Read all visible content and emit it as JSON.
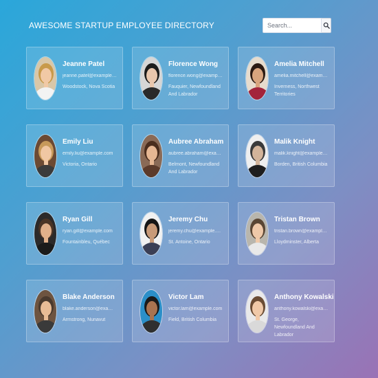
{
  "header": {
    "title": "AWESOME STARTUP EMPLOYEE DIRECTORY",
    "search_placeholder": "Search..."
  },
  "employees": [
    {
      "name": "Jeanne Patel",
      "email": "jeanne.patel@example.com",
      "location": "Woodstock, Nova Scotia",
      "avatar_colors": {
        "bg": "#d9c7a8",
        "hair": "#c89a4a",
        "skin": "#f1c9a5",
        "shirt": "#f3f3f3"
      }
    },
    {
      "name": "Florence Wong",
      "email": "florence.wong@example.com",
      "location": "Fauquier, Newfoundland And Labrador",
      "avatar_colors": {
        "bg": "#d6d6d6",
        "hair": "#1c1c1c",
        "skin": "#e9c7ad",
        "shirt": "#2a2a2a"
      }
    },
    {
      "name": "Amelia Mitchell",
      "email": "amelia.mitchell@example.com",
      "location": "Inverness, Northwest Territories",
      "avatar_colors": {
        "bg": "#e7dccd",
        "hair": "#2b1a12",
        "skin": "#d9a57e",
        "shirt": "#a3243b"
      }
    },
    {
      "name": "Emily Liu",
      "email": "emily.liu@example.com",
      "location": "Victoria, Ontario",
      "avatar_colors": {
        "bg": "#6c4a33",
        "hair": "#c79a5b",
        "skin": "#f0c7a3",
        "shirt": "#3b3b3b"
      }
    },
    {
      "name": "Aubree Abraham",
      "email": "aubree.abraham@example.com",
      "location": "Belmont, Newfoundland And Labrador",
      "avatar_colors": {
        "bg": "#8a6a56",
        "hair": "#4a2d1d",
        "skin": "#e6b793",
        "shirt": "#5c3b2b"
      }
    },
    {
      "name": "Malik Knight",
      "email": "malik.knight@example.com",
      "location": "Borden, British Columbia",
      "avatar_colors": {
        "bg": "#efefef",
        "hair": "#3a3a3a",
        "skin": "#d3b49a",
        "shirt": "#1e1e1e"
      }
    },
    {
      "name": "Ryan Gill",
      "email": "ryan.gill@example.com",
      "location": "Fountainbleu, Québec",
      "avatar_colors": {
        "bg": "#2c2a2a",
        "hair": "#4b3526",
        "skin": "#e1b08a",
        "shirt": "#1b1b1b"
      }
    },
    {
      "name": "Jeremy Chu",
      "email": "jeremy.chu@example.com",
      "location": "St. Antoine, Ontario",
      "avatar_colors": {
        "bg": "#f1f1f1",
        "hair": "#161616",
        "skin": "#c89a78",
        "shirt": "#3b3f55"
      }
    },
    {
      "name": "Tristan Brown",
      "email": "tristan.brown@example.com",
      "location": "Lloydminster, Alberta",
      "avatar_colors": {
        "bg": "#b9b6ad",
        "hair": "#5a4634",
        "skin": "#efc9a9",
        "shirt": "#e9e9e9"
      }
    },
    {
      "name": "Blake Anderson",
      "email": "blake.anderson@example.com",
      "location": "Armstrong, Nunavut",
      "avatar_colors": {
        "bg": "#6e5440",
        "hair": "#4a3a2e",
        "skin": "#e8bc96",
        "shirt": "#3a3a3a"
      }
    },
    {
      "name": "Victor Lam",
      "email": "victor.lam@example.com",
      "location": "Field, British Columbia",
      "avatar_colors": {
        "bg": "#2b8fc8",
        "hair": "#1a1a1a",
        "skin": "#a97350",
        "shirt": "#2f2f2f"
      }
    },
    {
      "name": "Anthony Kowalski",
      "email": "anthony.kowalski@example.com",
      "location": "St. George, Newfoundland And Labrador",
      "avatar_colors": {
        "bg": "#e9e9e9",
        "hair": "#6a4c34",
        "skin": "#f0c9a8",
        "shirt": "#d9d9d9"
      }
    }
  ]
}
